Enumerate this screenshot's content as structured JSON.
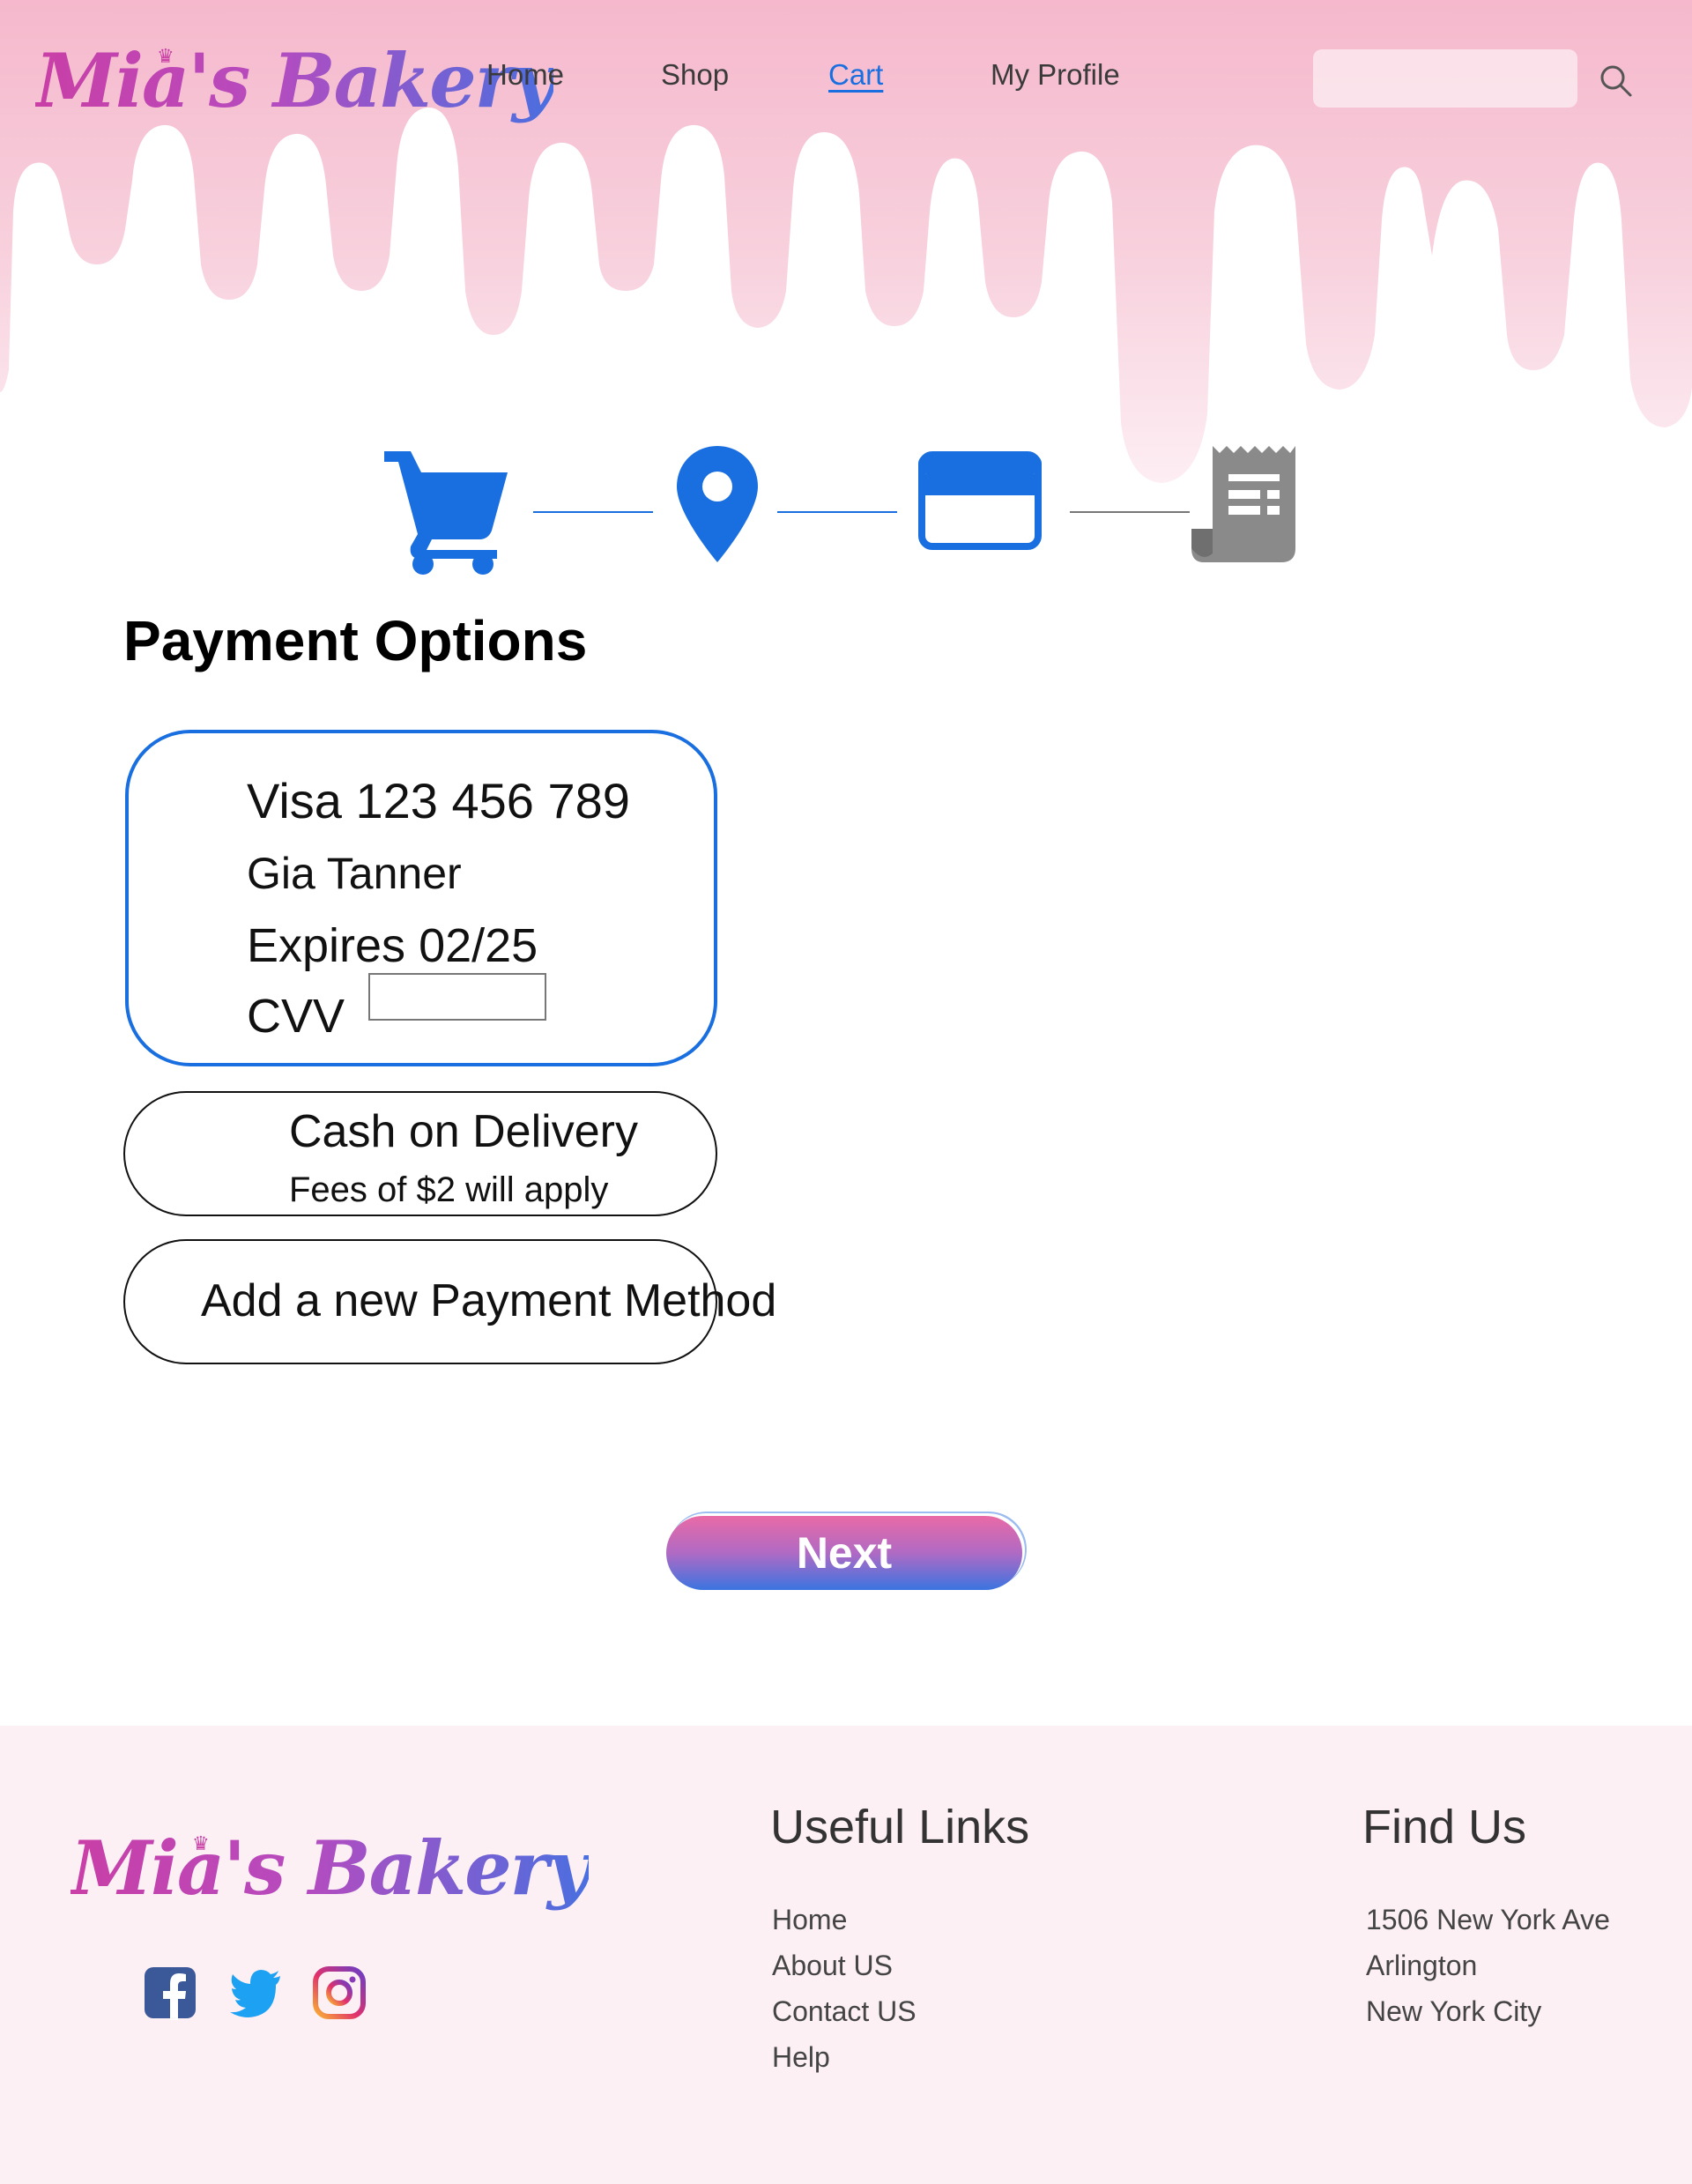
{
  "brand": {
    "name": "Mia's Bakery",
    "gradient_start": "#c93fa6",
    "gradient_end": "#4a6fe0",
    "drip_color": "#f5b8cc"
  },
  "nav": {
    "links": [
      {
        "label": "Home",
        "active": false
      },
      {
        "label": "Shop",
        "active": false
      },
      {
        "label": "Cart",
        "active": true
      },
      {
        "label": "My Profile",
        "active": false
      }
    ],
    "active_color": "#1a6fe0",
    "search_placeholder": ""
  },
  "stepper": {
    "steps": [
      {
        "icon": "cart-icon",
        "state": "done"
      },
      {
        "icon": "location-pin-icon",
        "state": "done"
      },
      {
        "icon": "credit-card-icon",
        "state": "current"
      },
      {
        "icon": "receipt-icon",
        "state": "pending"
      }
    ],
    "active_color": "#1a6fe0",
    "pending_color": "#8a8a8a"
  },
  "payment": {
    "title": "Payment Options",
    "saved_card": {
      "number_line": "Visa 123 456 789",
      "holder": "Gia Tanner",
      "expiry": "Expires 02/25",
      "cvv_label": "CVV",
      "cvv_value": "",
      "selected": true
    },
    "cash_on_delivery": {
      "title": "Cash on Delivery",
      "fee_note": "Fees of $2 will apply"
    },
    "add_method": {
      "label": "Add a new Payment Method"
    },
    "next_label": "Next"
  },
  "footer": {
    "useful_links_heading": "Useful Links",
    "links": [
      "Home",
      "About US",
      "Contact US",
      "Help"
    ],
    "find_us_heading": "Find Us",
    "address": [
      "1506 New York Ave",
      "Arlington",
      "New York City"
    ],
    "social": [
      "facebook-icon",
      "twitter-icon",
      "instagram-icon"
    ]
  }
}
